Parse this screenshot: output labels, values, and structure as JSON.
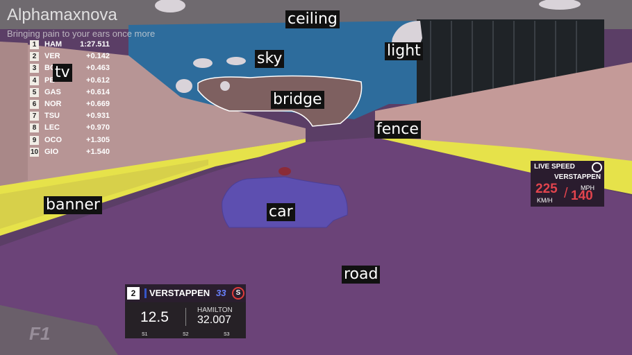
{
  "channel": {
    "name": "Alphamaxnova",
    "tagline": "Bringing pain to your ears once more"
  },
  "segmentation_labels": {
    "ceiling": "ceiling",
    "sky": "sky",
    "light": "light",
    "bridge": "bridge",
    "fence": "fence",
    "tv": "tv",
    "banner": "banner",
    "car": "car",
    "road": "road"
  },
  "leaderboard": [
    {
      "pos": "1",
      "driver": "HAM",
      "gap": "1:27.511"
    },
    {
      "pos": "2",
      "driver": "VER",
      "gap": "+0.142"
    },
    {
      "pos": "3",
      "driver": "BO",
      "gap": "+0.463"
    },
    {
      "pos": "4",
      "driver": "PE",
      "gap": "+0.612"
    },
    {
      "pos": "5",
      "driver": "GAS",
      "gap": "+0.614"
    },
    {
      "pos": "6",
      "driver": "NOR",
      "gap": "+0.669"
    },
    {
      "pos": "7",
      "driver": "TSU",
      "gap": "+0.931"
    },
    {
      "pos": "8",
      "driver": "LEC",
      "gap": "+0.970"
    },
    {
      "pos": "9",
      "driver": "OCO",
      "gap": "+1.305"
    },
    {
      "pos": "10",
      "driver": "GIO",
      "gap": "+1.540"
    }
  ],
  "live_speed": {
    "title": "LIVE SPEED",
    "driver": "VERSTAPPEN",
    "kmh_value": "225",
    "kmh_unit": "KM/H",
    "mph_value": "140",
    "mph_unit": "MPH"
  },
  "sector_widget": {
    "position": "2",
    "driver": "VERSTAPPEN",
    "number": "33",
    "tyre": "S",
    "gap": "12.5",
    "rival_name": "HAMILTON",
    "rival_time": "32.007",
    "sectors": [
      "S1",
      "S2",
      "S3"
    ]
  },
  "logo": "F1",
  "colors": {
    "road": "#6b4378",
    "sky": "#2d6c9c",
    "fence": "#c89a9a",
    "banner": "#e6e24a",
    "car": "#5d4fb0",
    "ceiling": "#6f6a6f",
    "bridge": "#8a6a6a",
    "light": "#d9d3d9"
  }
}
